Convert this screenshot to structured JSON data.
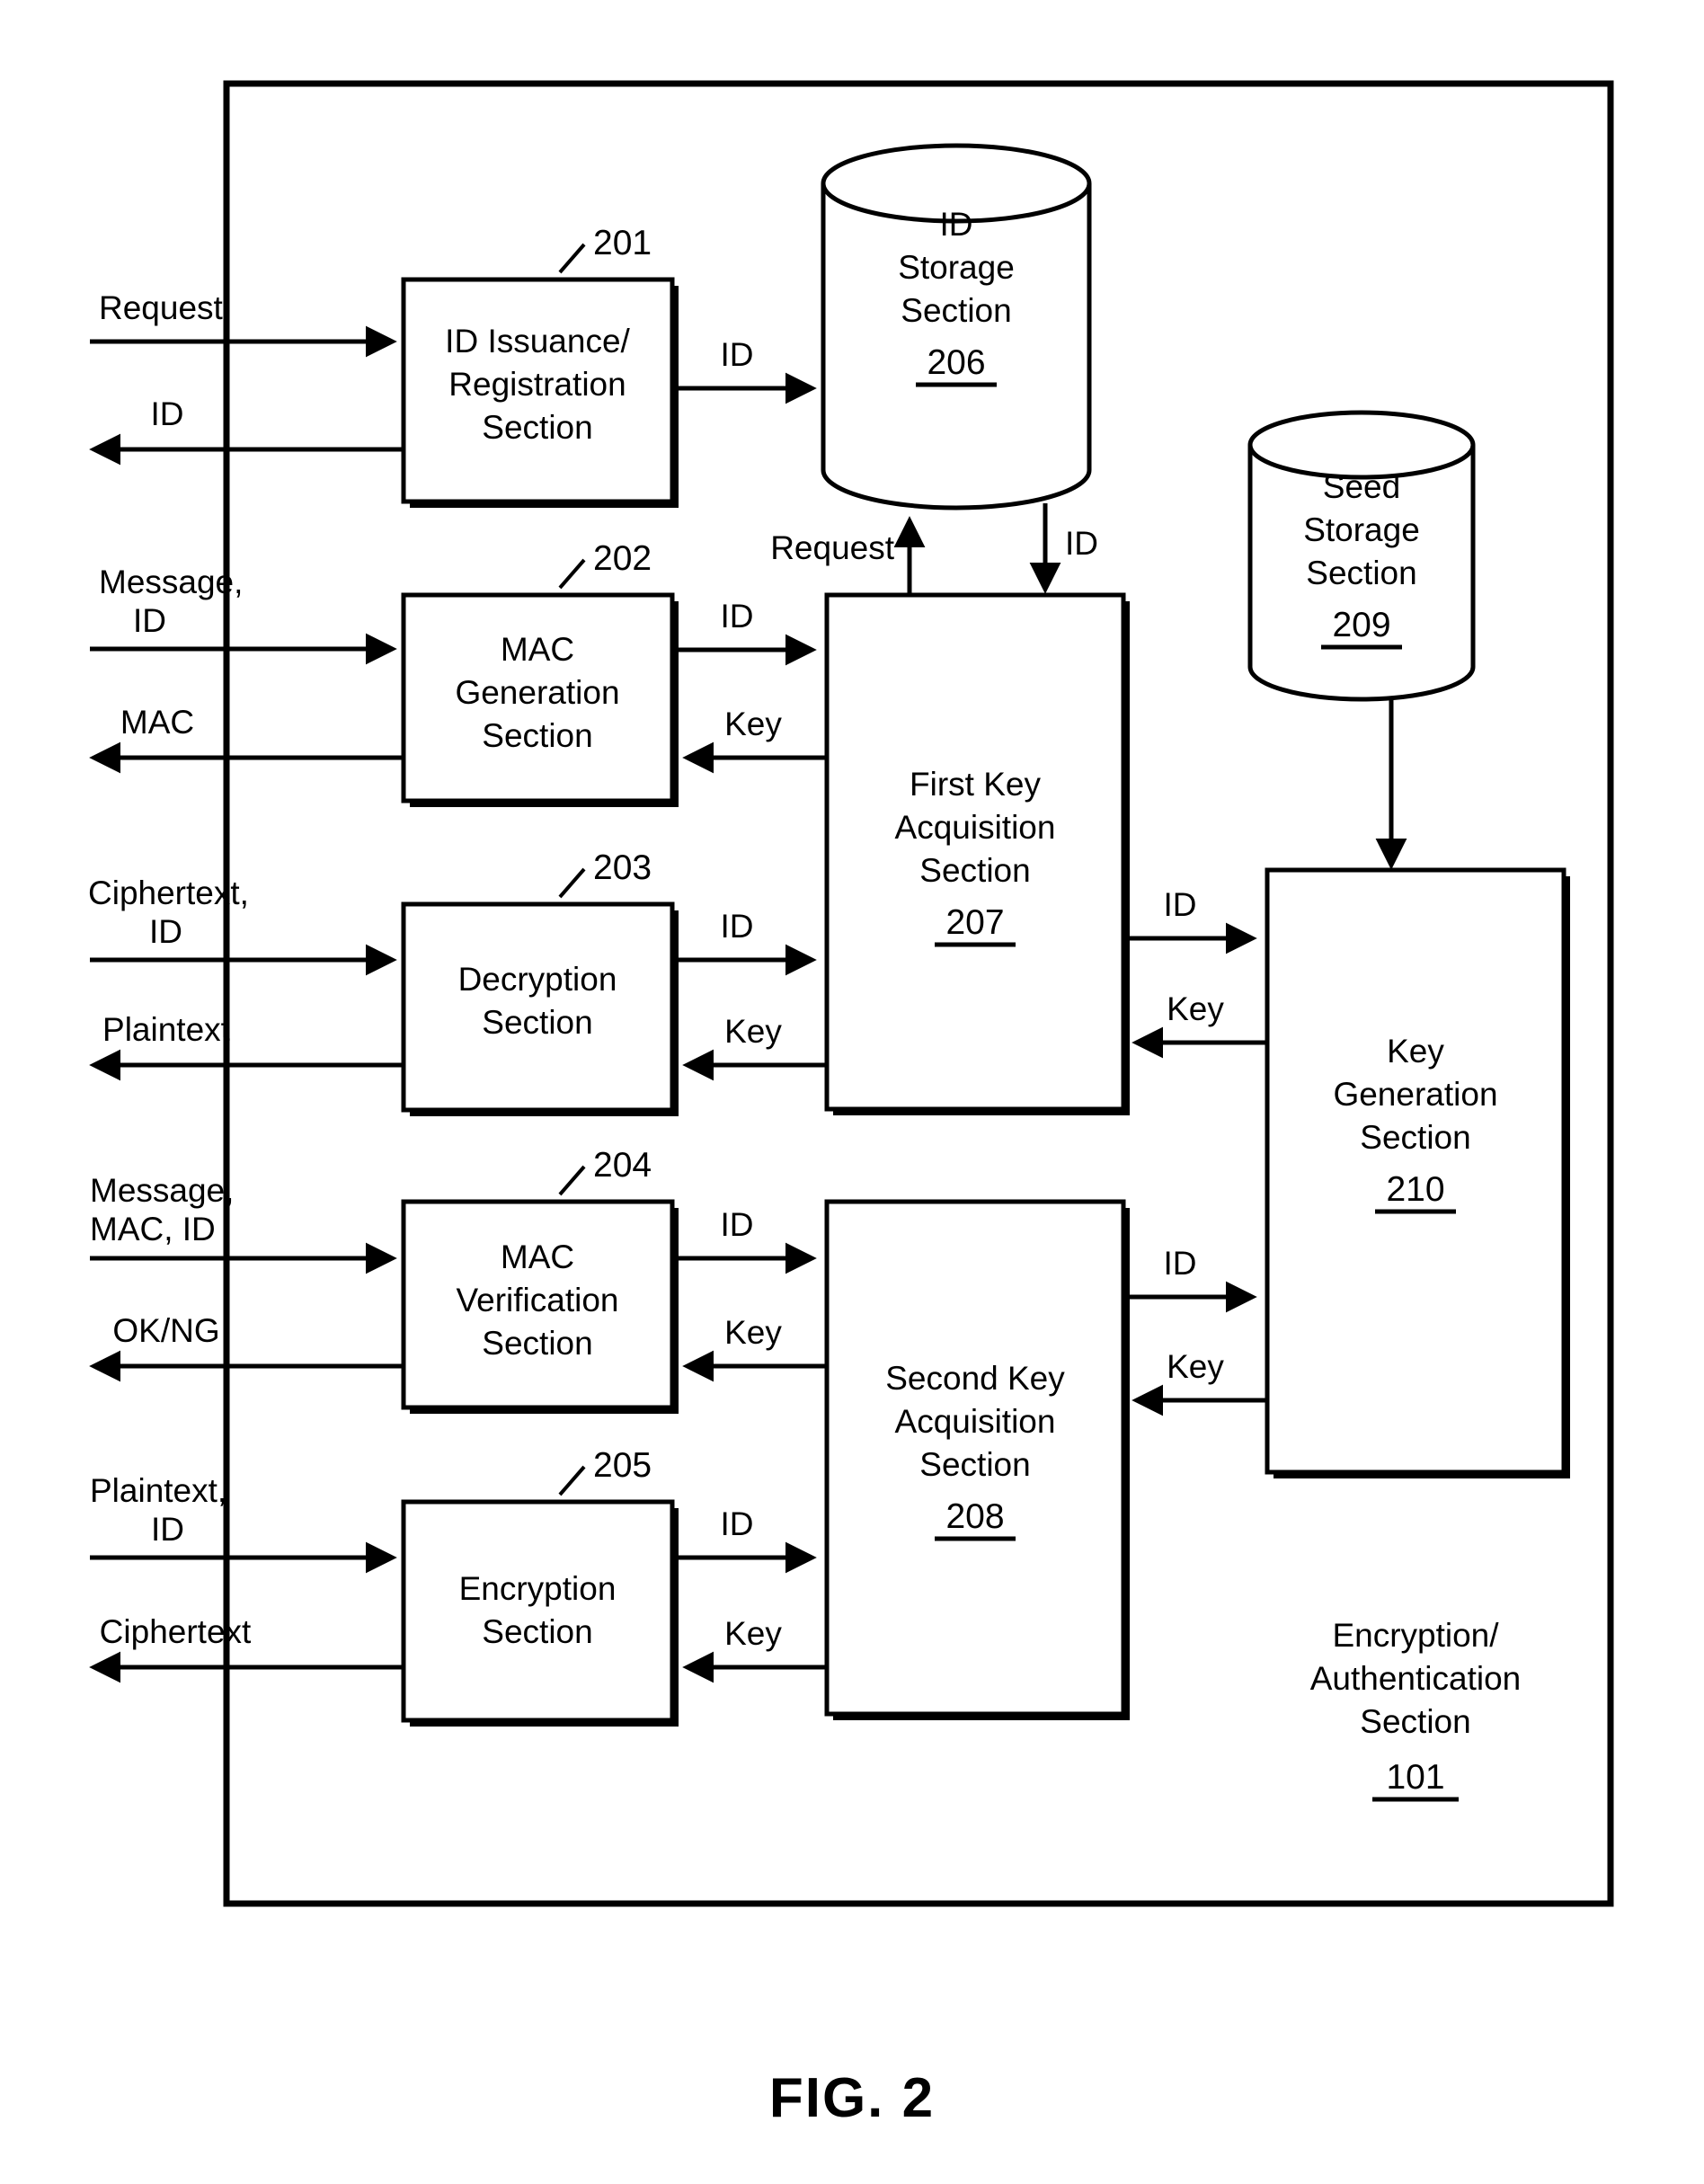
{
  "figure": {
    "caption": "FIG. 2",
    "outer_container": {
      "label_line1": "Encryption/",
      "label_line2": "Authentication",
      "label_line3": "Section",
      "ref": "101"
    }
  },
  "blocks": [
    {
      "id": "id-issuance-registration",
      "ref": "201",
      "lines": [
        "ID Issuance/",
        "Registration",
        "Section"
      ],
      "shape": "rect"
    },
    {
      "id": "mac-generation",
      "ref": "202",
      "lines": [
        "MAC",
        "Generation",
        "Section"
      ],
      "shape": "rect"
    },
    {
      "id": "decryption",
      "ref": "203",
      "lines": [
        "Decryption",
        "Section"
      ],
      "shape": "rect"
    },
    {
      "id": "mac-verification",
      "ref": "204",
      "lines": [
        "MAC",
        "Verification",
        "Section"
      ],
      "shape": "rect"
    },
    {
      "id": "encryption",
      "ref": "205",
      "lines": [
        "Encryption",
        "Section"
      ],
      "shape": "rect"
    },
    {
      "id": "id-storage",
      "ref": "206",
      "lines": [
        "ID",
        "Storage",
        "Section"
      ],
      "shape": "cylinder"
    },
    {
      "id": "first-key-acquisition",
      "ref": "207",
      "lines": [
        "First Key",
        "Acquisition",
        "Section"
      ],
      "shape": "rect"
    },
    {
      "id": "second-key-acquisition",
      "ref": "208",
      "lines": [
        "Second Key",
        "Acquisition",
        "Section"
      ],
      "shape": "rect"
    },
    {
      "id": "seed-storage",
      "ref": "209",
      "lines": [
        "Seed",
        "Storage",
        "Section"
      ],
      "shape": "cylinder"
    },
    {
      "id": "key-generation",
      "ref": "210",
      "lines": [
        "Key",
        "Generation",
        "Section"
      ],
      "shape": "rect"
    }
  ],
  "io_labels": {
    "request_in": "Request",
    "id_out": "ID",
    "message_id_in_l1": "Message,",
    "message_id_in_l2": "ID",
    "mac_out": "MAC",
    "ciphertext_id_in_l1": "Ciphertext,",
    "ciphertext_id_in_l2": "ID",
    "plaintext_out": "Plaintext",
    "message_mac_id_in_l1": "Message,",
    "message_mac_id_in_l2": "MAC, ID",
    "ok_ng_out": "OK/NG",
    "plaintext_id_in_l1": "Plaintext,",
    "plaintext_id_in_l2": "ID",
    "ciphertext_out": "Ciphertext"
  },
  "flow_labels": {
    "id_201_to_206": "ID",
    "request_207_to_206": "Request",
    "id_206_to_207": "ID",
    "id_202_to_207": "ID",
    "key_207_to_202": "Key",
    "id_203_to_207": "ID",
    "key_207_to_203": "Key",
    "id_207_to_210": "ID",
    "key_210_to_207": "Key",
    "id_204_to_208": "ID",
    "key_208_to_204": "Key",
    "id_205_to_208": "ID",
    "key_208_to_205": "Key",
    "id_208_to_210": "ID",
    "key_210_to_208": "Key"
  },
  "refs": {
    "r201": "201",
    "r202": "202",
    "r203": "203",
    "r204": "204",
    "r205": "205",
    "r206": "206",
    "r207": "207",
    "r208": "208",
    "r209": "209",
    "r210": "210",
    "r101": "101"
  },
  "colors": {
    "ink": "#000000",
    "paper": "#ffffff"
  }
}
